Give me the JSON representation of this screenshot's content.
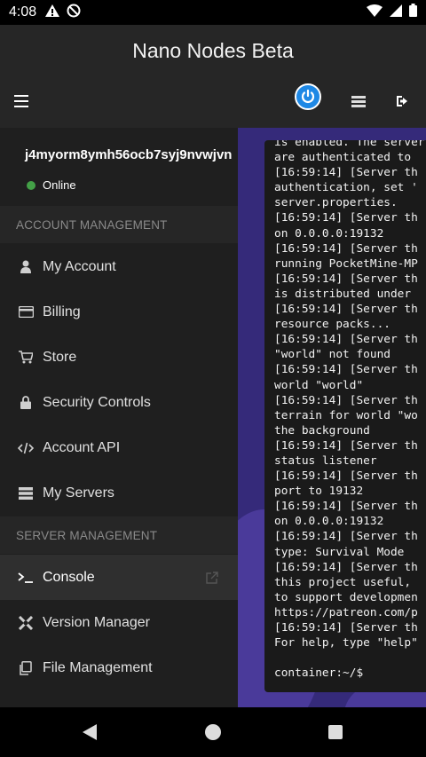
{
  "status_bar": {
    "time": "4:08",
    "icons": [
      "alert-icon",
      "do-not-disturb-icon",
      "wifi-icon",
      "signal-icon",
      "battery-icon"
    ]
  },
  "app_bar": {
    "title": "Nano Nodes Beta",
    "icons": [
      "menu-icon",
      "power-icon",
      "servers-icon",
      "logout-icon"
    ],
    "accent_color": "#1e88e5"
  },
  "drawer": {
    "user_id": "j4myorm8ymh56ocb7syj9nvwjvn",
    "status": "Online",
    "status_color": "#43a047",
    "sections": [
      {
        "title": "ACCOUNT MANAGEMENT",
        "items": [
          {
            "label": "My Account",
            "icon": "user-icon"
          },
          {
            "label": "Billing",
            "icon": "credit-card-icon"
          },
          {
            "label": "Store",
            "icon": "cart-icon"
          },
          {
            "label": "Security Controls",
            "icon": "lock-icon"
          },
          {
            "label": "Account API",
            "icon": "code-icon"
          },
          {
            "label": "My Servers",
            "icon": "servers-icon"
          }
        ]
      },
      {
        "title": "SERVER MANAGEMENT",
        "items": [
          {
            "label": "Console",
            "icon": "terminal-icon",
            "active": true
          },
          {
            "label": "Version Manager",
            "icon": "version-icon"
          },
          {
            "label": "File Management",
            "icon": "files-icon"
          }
        ]
      }
    ]
  },
  "console": {
    "lines": [
      "is enabled. The server",
      "are authenticated to",
      "[16:59:14] [Server th",
      "authentication, set '",
      "server.properties.",
      "[16:59:14] [Server th",
      "on 0.0.0.0:19132",
      "[16:59:14] [Server th",
      "running PocketMine-MP",
      "[16:59:14] [Server th",
      "is distributed under",
      "[16:59:14] [Server th",
      "resource packs...",
      "[16:59:14] [Server th",
      "\"world\" not found",
      "[16:59:14] [Server th",
      "world \"world\"",
      "[16:59:14] [Server th",
      "terrain for world \"wo",
      "the background",
      "[16:59:14] [Server th",
      "status listener",
      "[16:59:14] [Server th",
      "port to 19132",
      "[16:59:14] [Server th",
      "on 0.0.0.0:19132",
      "[16:59:14] [Server th",
      "type: Survival Mode",
      "[16:59:14] [Server th",
      "this project useful,",
      "to support developmen",
      "https://patreon.com/p",
      "[16:59:14] [Server th",
      "For help, type \"help\""
    ],
    "prompt": "container:~/$"
  }
}
